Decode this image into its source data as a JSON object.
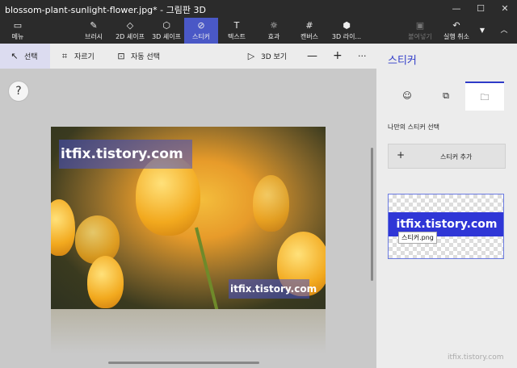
{
  "title": "blossom-plant-sunlight-flower.jpg* - 그림판 3D",
  "toolbar": {
    "menu": "메뉴",
    "brush": "브러시",
    "shapes2d": "2D 셰이프",
    "shapes3d": "3D 셰이프",
    "stickers": "스티커",
    "text": "텍스트",
    "effects": "효과",
    "canvas": "캔버스",
    "library3d": "3D 라이...",
    "paste": "붙여넣기",
    "undo": "실행 취소"
  },
  "subbar": {
    "select": "선택",
    "crop": "자르기",
    "magic_select": "자동 선택",
    "view3d": "3D 보기"
  },
  "canvas": {
    "help": "?",
    "watermark_top": "itfix.tistory.com",
    "watermark_bottom": "itfix.tistory.com"
  },
  "panel": {
    "title": "스티커",
    "my_stickers_label": "나만의 스티커 선택",
    "add_sticker": "스티커 추가",
    "sticker_text": "itfix.tistory.com",
    "sticker_filename": "스티커.png"
  },
  "footer": "itfix.tistory.com",
  "colors": {
    "accent": "#4a58c6",
    "titlebar": "#2b2b2b",
    "panel": "#ececec"
  }
}
